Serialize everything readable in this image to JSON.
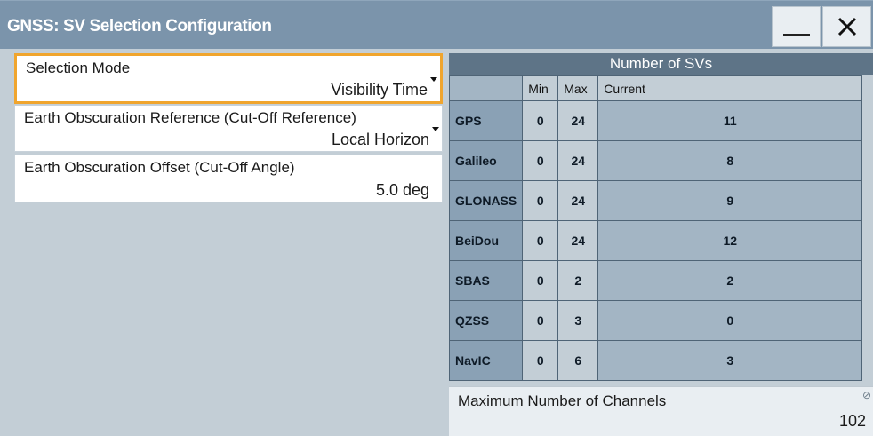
{
  "window": {
    "title": "GNSS: SV Selection Configuration",
    "minimize_icon": "minimize-icon",
    "close_icon": "close-icon",
    "close_glyph": "✕"
  },
  "settings": {
    "selection_mode": {
      "label": "Selection Mode",
      "value": "Visibility Time"
    },
    "cutoff_reference": {
      "label": "Earth Obscuration Reference (Cut-Off Reference)",
      "value": "Local Horizon"
    },
    "cutoff_offset": {
      "label": "Earth Obscuration Offset (Cut-Off Angle)",
      "value": "5.0 deg"
    }
  },
  "sv_table": {
    "title": "Number of SVs",
    "headers": {
      "min": "Min",
      "max": "Max",
      "current": "Current"
    },
    "rows": [
      {
        "system": "GPS",
        "min": "0",
        "max": "24",
        "current": "11"
      },
      {
        "system": "Galileo",
        "min": "0",
        "max": "24",
        "current": "8"
      },
      {
        "system": "GLONASS",
        "min": "0",
        "max": "24",
        "current": "9"
      },
      {
        "system": "BeiDou",
        "min": "0",
        "max": "24",
        "current": "12"
      },
      {
        "system": "SBAS",
        "min": "0",
        "max": "2",
        "current": "2"
      },
      {
        "system": "QZSS",
        "min": "0",
        "max": "3",
        "current": "0"
      },
      {
        "system": "NavIC",
        "min": "0",
        "max": "6",
        "current": "3"
      }
    ]
  },
  "channels": {
    "label": "Maximum Number of Channels",
    "value": "102",
    "icon": "edit-pencil-icon"
  },
  "colors": {
    "title_bar": "#7b94ab",
    "focus_border": "#f0a52e",
    "table_header": "#5e7487",
    "system_cell": "#8aa1b5",
    "current_cell": "#a3b5c4",
    "background": "#c3ced6"
  }
}
